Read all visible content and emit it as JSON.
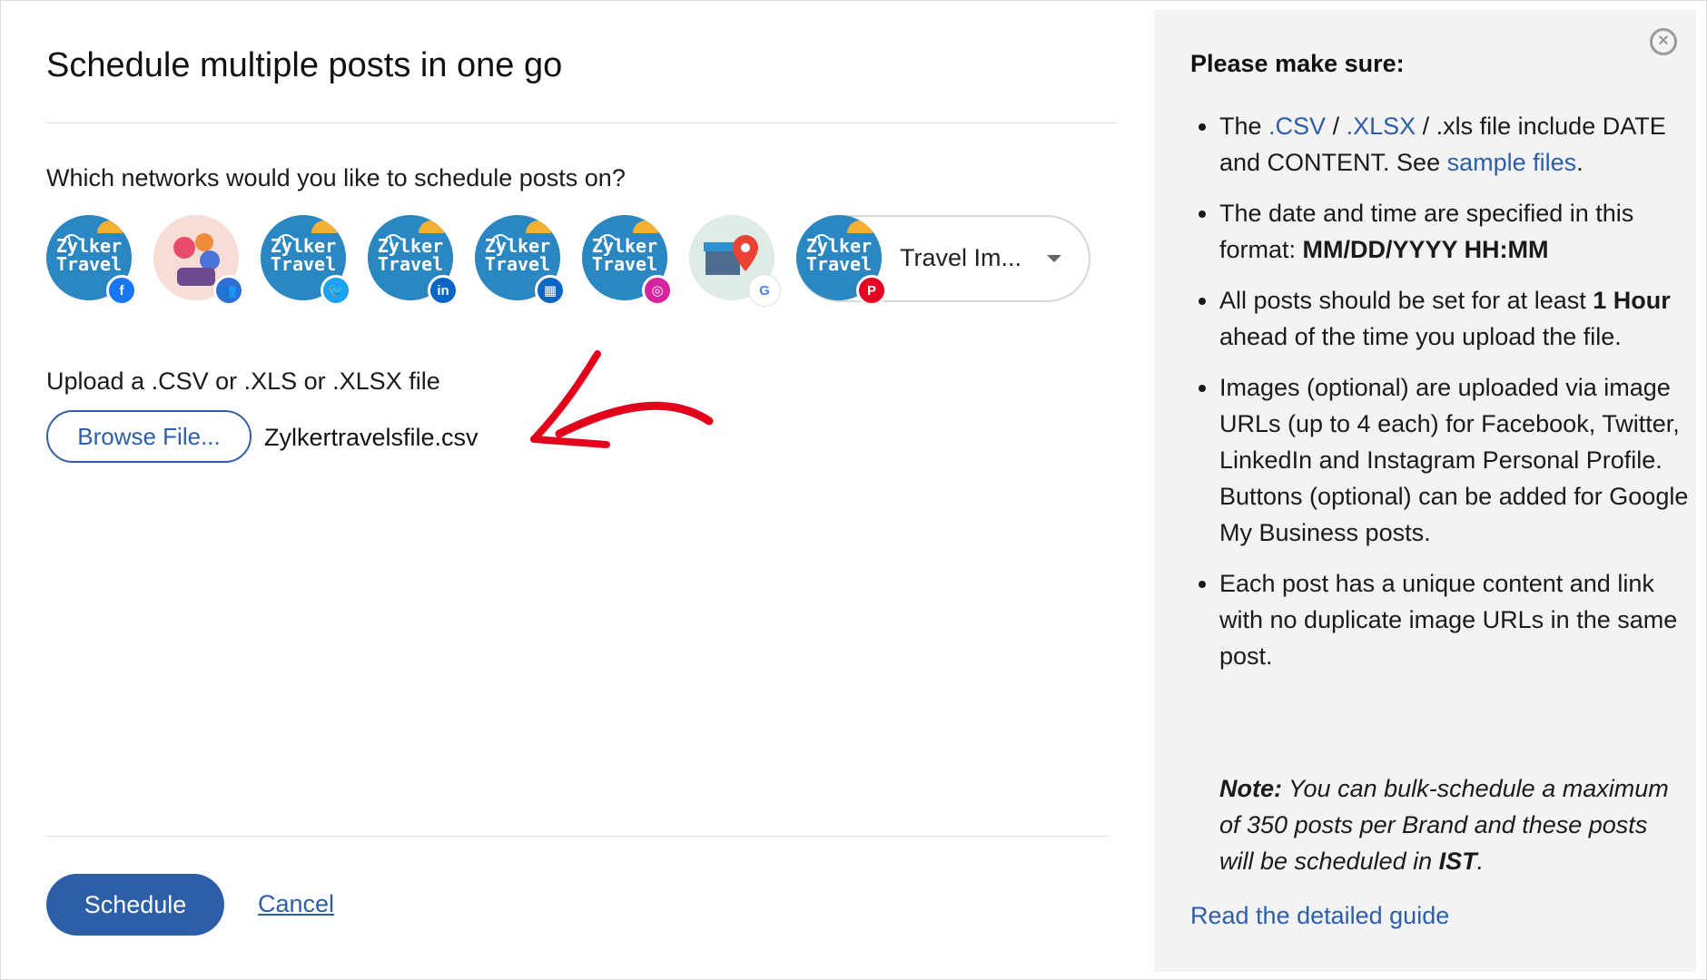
{
  "modal": {
    "title": "Schedule multiple posts in one go",
    "network_question": "Which networks would you like to schedule posts on?",
    "networks": [
      {
        "name": "Zylker Travel",
        "network": "facebook",
        "icon": "facebook-icon",
        "color": "#1877f2"
      },
      {
        "name": "Group",
        "network": "facebook-group",
        "icon": "group-icon",
        "color": "#2d6fd2"
      },
      {
        "name": "Zylker Travel",
        "network": "twitter",
        "icon": "twitter-icon",
        "color": "#1da1f2"
      },
      {
        "name": "Zylker Travel",
        "network": "linkedin",
        "icon": "linkedin-icon",
        "color": "#0a66c2"
      },
      {
        "name": "Zylker Travel",
        "network": "linkedin-page",
        "icon": "building-icon",
        "color": "#0a66c2"
      },
      {
        "name": "Zylker Travel",
        "network": "instagram",
        "icon": "instagram-icon",
        "color": "#d6249f"
      },
      {
        "name": "Google My Business",
        "network": "google",
        "icon": "google-icon",
        "color": "#4285f4"
      },
      {
        "name": "Zylker Travel",
        "network": "pinterest",
        "icon": "pinterest-icon",
        "color": "#e60023"
      }
    ],
    "brand_select": {
      "value": "Travel Im..."
    },
    "avatar_text": {
      "line1": "Zylker",
      "line2": "Travel"
    },
    "upload_label": "Upload a .CSV or .XLS or .XLSX file",
    "browse_label": "Browse File...",
    "file_name": "Zylkertravelsfile.csv",
    "schedule_label": "Schedule",
    "cancel_label": "Cancel",
    "accent_color": "#2d5ea8",
    "annotation_arrow_color": "#e3001b"
  },
  "side": {
    "heading": "Please make sure:",
    "tip1": {
      "t1": "The ",
      "csv": ".CSV",
      "sep1": " / ",
      "xlsx": ".XLSX",
      "t2": " / .xls file include DATE and CONTENT. See ",
      "sample": "sample files",
      "t3": "."
    },
    "tip2": {
      "t1": "The date and time are specified in this format: ",
      "format": "MM/DD/YYYY HH:MM"
    },
    "tip3": {
      "t1": "All posts should be set for at least ",
      "bold": "1 Hour",
      "t2": " ahead of the time you upload the file."
    },
    "tip4": "Images (optional) are uploaded via image URLs (up to 4 each) for Facebook, Twitter, LinkedIn and Instagram Personal Profile. Buttons (optional) can be added for Google My Business posts.",
    "tip5": "Each post has a unique content and link with no duplicate image URLs in the same post.",
    "note": {
      "label": "Note:",
      "t1": " You can bulk-schedule a maximum of 350 posts per Brand and these posts will be scheduled in ",
      "tz": "IST",
      "t2": "."
    },
    "guide_link": "Read the detailed guide"
  }
}
